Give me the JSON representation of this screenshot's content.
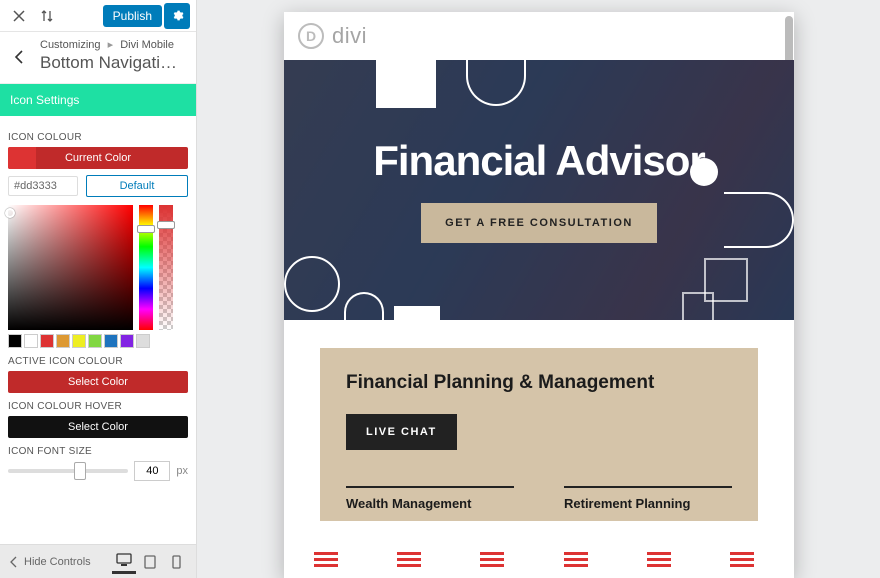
{
  "header": {
    "publish": "Publish"
  },
  "breadcrumb": {
    "root": "Customizing",
    "parent": "Divi Mobile",
    "title": "Bottom Navigation Sett…"
  },
  "subsection": "Icon Settings",
  "fields": {
    "icon_colour": {
      "label": "ICON COLOUR",
      "bar": "Current Color",
      "hex": "#dd3333",
      "default_btn": "Default",
      "swatches": [
        "#000000",
        "#ffffff",
        "#dd3333",
        "#dd9933",
        "#eeee22",
        "#81d742",
        "#1e73be",
        "#8224e3",
        "#dddddd"
      ]
    },
    "active_icon_colour": {
      "label": "ACTIVE ICON COLOUR",
      "bar": "Select Color"
    },
    "icon_colour_hover": {
      "label": "ICON COLOUR HOVER",
      "bar": "Select Color"
    },
    "icon_font_size": {
      "label": "ICON FONT SIZE",
      "value": "40",
      "unit": "px"
    }
  },
  "footer": {
    "hide": "Hide Controls"
  },
  "preview": {
    "brand": "divi",
    "hero_title": "Financial Advisor",
    "cta": "GET A FREE CONSULTATION",
    "section_title": "Financial Planning & Management",
    "chat": "LIVE CHAT",
    "services": [
      "Wealth Management",
      "Retirement Planning"
    ]
  }
}
